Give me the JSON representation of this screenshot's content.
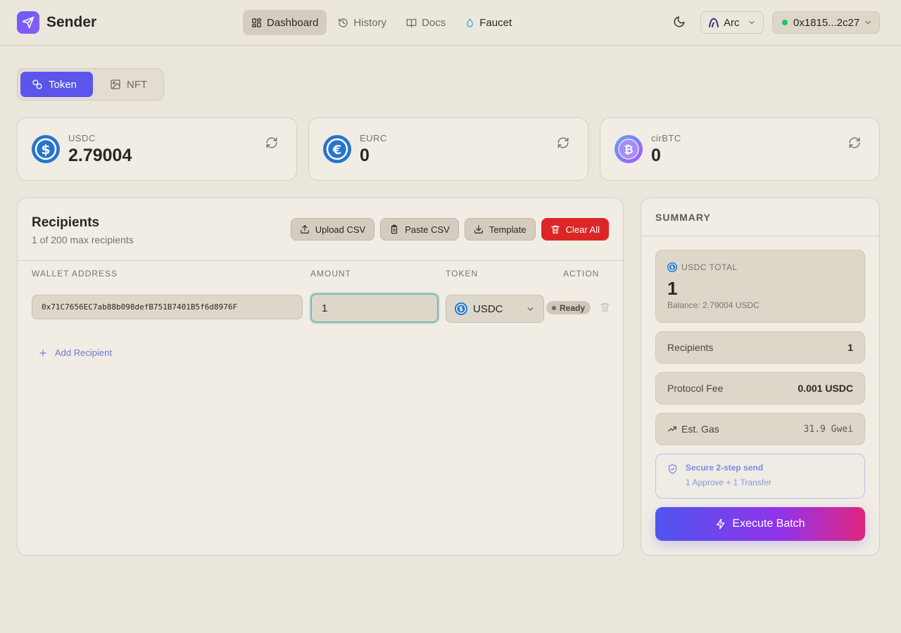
{
  "app": {
    "name": "Sender"
  },
  "nav": {
    "dashboard": "Dashboard",
    "history": "History",
    "docs": "Docs",
    "faucet": "Faucet"
  },
  "header": {
    "network": "Arc",
    "wallet": "0x1815...2c27"
  },
  "mode_tabs": {
    "token": "Token",
    "nft": "NFT"
  },
  "balances": [
    {
      "symbol": "USDC",
      "amount": "2.79004"
    },
    {
      "symbol": "EURC",
      "amount": "0"
    },
    {
      "symbol": "cirBTC",
      "amount": "0"
    }
  ],
  "recipients": {
    "title": "Recipients",
    "subtitle": "1 of 200 max recipients",
    "actions": {
      "upload_csv": "Upload CSV",
      "paste_csv": "Paste CSV",
      "template": "Template",
      "clear_all": "Clear All"
    },
    "columns": {
      "wallet": "WALLET ADDRESS",
      "amount": "AMOUNT",
      "token": "TOKEN",
      "action": "ACTION"
    },
    "rows": [
      {
        "address": "0x71C7656EC7ab88b098defB751B7401B5f6d8976F",
        "amount": "1",
        "token": "USDC",
        "status": "Ready"
      }
    ],
    "add_label": "Add Recipient"
  },
  "summary": {
    "title": "SUMMARY",
    "total_label": "USDC TOTAL",
    "total_value": "1",
    "balance_text": "Balance: 2.79004 USDC",
    "recipients_label": "Recipients",
    "recipients_value": "1",
    "fee_label": "Protocol Fee",
    "fee_value": "0.001 USDC",
    "gas_label": "Est. Gas",
    "gas_value": "31.9 Gwei",
    "secure_title": "Secure 2-step send",
    "secure_sub": "1 Approve + 1 Transfer",
    "execute_label": "Execute Batch"
  },
  "colors": {
    "accent": "#5b55ec",
    "danger": "#dc2626",
    "usdc": "#2775ca",
    "online": "#22c55e"
  },
  "icons": {
    "brand": "send-icon",
    "dashboard": "grid-icon",
    "history": "history-icon",
    "docs": "book-icon",
    "faucet": "droplet-icon",
    "theme": "moon-icon",
    "refresh": "refresh-icon",
    "delete": "trash-icon"
  }
}
